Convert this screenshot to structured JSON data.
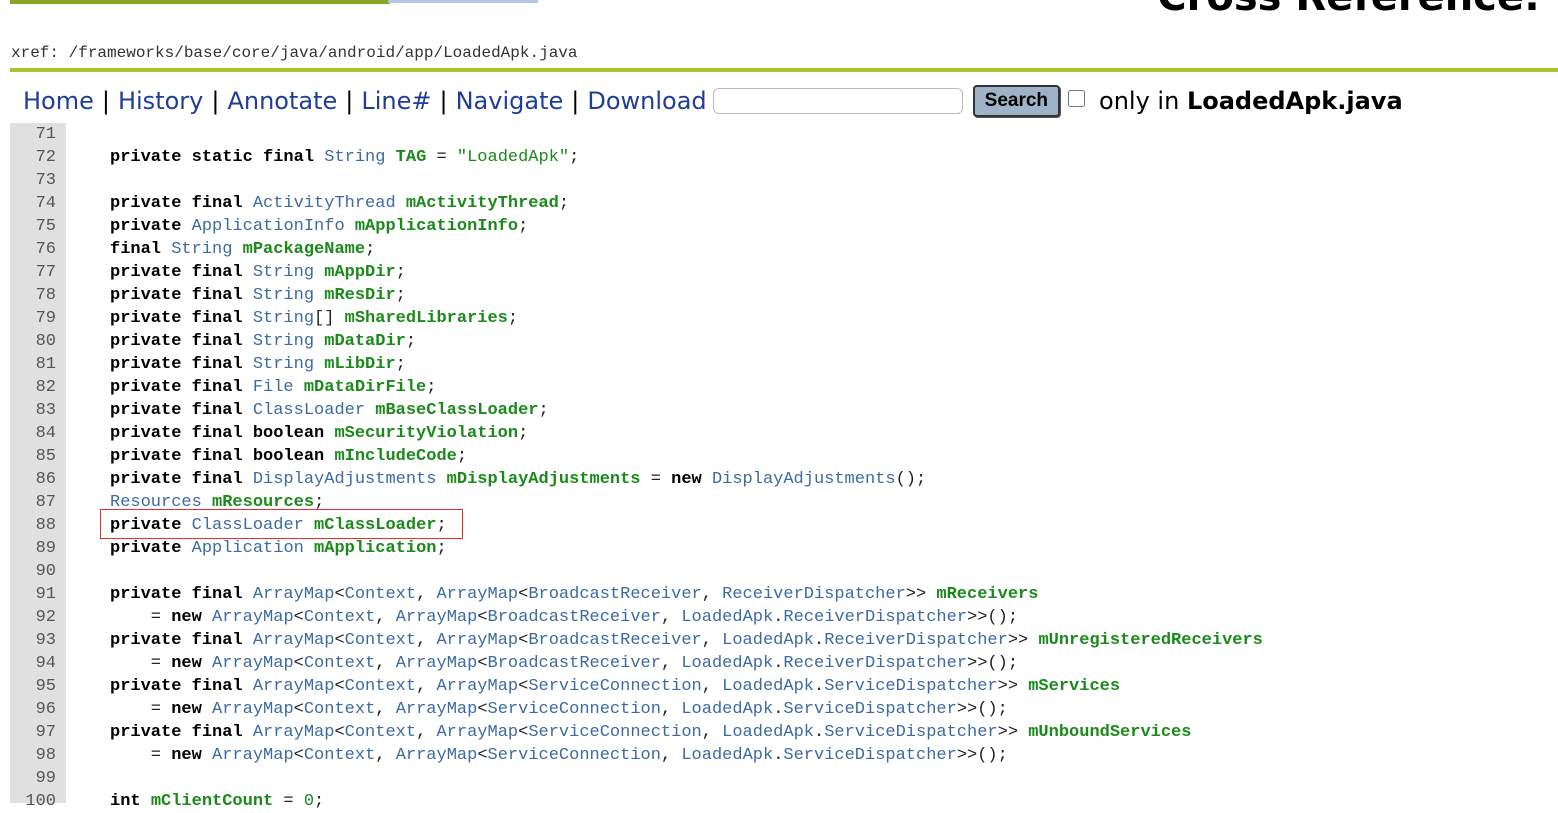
{
  "header": {
    "cross_reference": "Cross Reference:",
    "xref_path": "xref: /frameworks/base/core/java/android/app/LoadedApk.java"
  },
  "nav": {
    "home": "Home",
    "history": "History",
    "annotate": "Annotate",
    "line": "Line#",
    "navigate": "Navigate",
    "download": "Download",
    "search_value": "",
    "search_button": "Search",
    "only_in_prefix": "only in",
    "only_in_file": "LoadedApk.java"
  },
  "code": {
    "lines": [
      {
        "n": "71",
        "segs": []
      },
      {
        "n": "72",
        "segs": [
          [
            "k",
            "private static final "
          ],
          [
            "t",
            "String "
          ],
          [
            "d",
            "TAG"
          ],
          [
            "p",
            " = "
          ],
          [
            "s",
            "\"LoadedApk\""
          ],
          [
            "p",
            ";"
          ]
        ]
      },
      {
        "n": "73",
        "segs": []
      },
      {
        "n": "74",
        "segs": [
          [
            "k",
            "private final "
          ],
          [
            "t",
            "ActivityThread "
          ],
          [
            "d",
            "mActivityThread"
          ],
          [
            "p",
            ";"
          ]
        ]
      },
      {
        "n": "75",
        "segs": [
          [
            "k",
            "private "
          ],
          [
            "t",
            "ApplicationInfo "
          ],
          [
            "d",
            "mApplicationInfo"
          ],
          [
            "p",
            ";"
          ]
        ]
      },
      {
        "n": "76",
        "segs": [
          [
            "k",
            "final "
          ],
          [
            "t",
            "String "
          ],
          [
            "d",
            "mPackageName"
          ],
          [
            "p",
            ";"
          ]
        ]
      },
      {
        "n": "77",
        "segs": [
          [
            "k",
            "private final "
          ],
          [
            "t",
            "String "
          ],
          [
            "d",
            "mAppDir"
          ],
          [
            "p",
            ";"
          ]
        ]
      },
      {
        "n": "78",
        "segs": [
          [
            "k",
            "private final "
          ],
          [
            "t",
            "String "
          ],
          [
            "d",
            "mResDir"
          ],
          [
            "p",
            ";"
          ]
        ]
      },
      {
        "n": "79",
        "segs": [
          [
            "k",
            "private final "
          ],
          [
            "t",
            "String"
          ],
          [
            "p",
            "[] "
          ],
          [
            "d",
            "mSharedLibraries"
          ],
          [
            "p",
            ";"
          ]
        ]
      },
      {
        "n": "80",
        "segs": [
          [
            "k",
            "private final "
          ],
          [
            "t",
            "String "
          ],
          [
            "d",
            "mDataDir"
          ],
          [
            "p",
            ";"
          ]
        ]
      },
      {
        "n": "81",
        "segs": [
          [
            "k",
            "private final "
          ],
          [
            "t",
            "String "
          ],
          [
            "d",
            "mLibDir"
          ],
          [
            "p",
            ";"
          ]
        ]
      },
      {
        "n": "82",
        "segs": [
          [
            "k",
            "private final "
          ],
          [
            "t",
            "File "
          ],
          [
            "d",
            "mDataDirFile"
          ],
          [
            "p",
            ";"
          ]
        ]
      },
      {
        "n": "83",
        "segs": [
          [
            "k",
            "private final "
          ],
          [
            "t",
            "ClassLoader "
          ],
          [
            "d",
            "mBaseClassLoader"
          ],
          [
            "p",
            ";"
          ]
        ]
      },
      {
        "n": "84",
        "segs": [
          [
            "k",
            "private final boolean "
          ],
          [
            "d",
            "mSecurityViolation"
          ],
          [
            "p",
            ";"
          ]
        ]
      },
      {
        "n": "85",
        "segs": [
          [
            "k",
            "private final boolean "
          ],
          [
            "d",
            "mIncludeCode"
          ],
          [
            "p",
            ";"
          ]
        ]
      },
      {
        "n": "86",
        "segs": [
          [
            "k",
            "private final "
          ],
          [
            "t",
            "DisplayAdjustments "
          ],
          [
            "d",
            "mDisplayAdjustments"
          ],
          [
            "p",
            " = "
          ],
          [
            "k",
            "new "
          ],
          [
            "t",
            "DisplayAdjustments"
          ],
          [
            "p",
            "();"
          ]
        ]
      },
      {
        "n": "87",
        "segs": [
          [
            "t",
            "Resources "
          ],
          [
            "d",
            "mResources"
          ],
          [
            "p",
            ";"
          ]
        ]
      },
      {
        "n": "88",
        "segs": [
          [
            "k",
            "private "
          ],
          [
            "t",
            "ClassLoader "
          ],
          [
            "d",
            "mClassLoader"
          ],
          [
            "p",
            ";"
          ]
        ]
      },
      {
        "n": "89",
        "segs": [
          [
            "k",
            "private "
          ],
          [
            "t",
            "Application "
          ],
          [
            "d",
            "mApplication"
          ],
          [
            "p",
            ";"
          ]
        ]
      },
      {
        "n": "90",
        "segs": []
      },
      {
        "n": "91",
        "segs": [
          [
            "k",
            "private final "
          ],
          [
            "t",
            "ArrayMap"
          ],
          [
            "p",
            "<"
          ],
          [
            "t",
            "Context"
          ],
          [
            "p",
            ", "
          ],
          [
            "t",
            "ArrayMap"
          ],
          [
            "p",
            "<"
          ],
          [
            "t",
            "BroadcastReceiver"
          ],
          [
            "p",
            ", "
          ],
          [
            "t",
            "ReceiverDispatcher"
          ],
          [
            "p",
            ">> "
          ],
          [
            "d",
            "mReceivers"
          ]
        ]
      },
      {
        "n": "92",
        "segs": [
          [
            "p",
            "    = "
          ],
          [
            "k",
            "new "
          ],
          [
            "t",
            "ArrayMap"
          ],
          [
            "p",
            "<"
          ],
          [
            "t",
            "Context"
          ],
          [
            "p",
            ", "
          ],
          [
            "t",
            "ArrayMap"
          ],
          [
            "p",
            "<"
          ],
          [
            "t",
            "BroadcastReceiver"
          ],
          [
            "p",
            ", "
          ],
          [
            "t",
            "LoadedApk"
          ],
          [
            "p",
            "."
          ],
          [
            "t",
            "ReceiverDispatcher"
          ],
          [
            "p",
            ">>();"
          ]
        ]
      },
      {
        "n": "93",
        "segs": [
          [
            "k",
            "private final "
          ],
          [
            "t",
            "ArrayMap"
          ],
          [
            "p",
            "<"
          ],
          [
            "t",
            "Context"
          ],
          [
            "p",
            ", "
          ],
          [
            "t",
            "ArrayMap"
          ],
          [
            "p",
            "<"
          ],
          [
            "t",
            "BroadcastReceiver"
          ],
          [
            "p",
            ", "
          ],
          [
            "t",
            "LoadedApk"
          ],
          [
            "p",
            "."
          ],
          [
            "t",
            "ReceiverDispatcher"
          ],
          [
            "p",
            ">> "
          ],
          [
            "d",
            "mUnregisteredReceivers"
          ]
        ]
      },
      {
        "n": "94",
        "segs": [
          [
            "p",
            "    = "
          ],
          [
            "k",
            "new "
          ],
          [
            "t",
            "ArrayMap"
          ],
          [
            "p",
            "<"
          ],
          [
            "t",
            "Context"
          ],
          [
            "p",
            ", "
          ],
          [
            "t",
            "ArrayMap"
          ],
          [
            "p",
            "<"
          ],
          [
            "t",
            "BroadcastReceiver"
          ],
          [
            "p",
            ", "
          ],
          [
            "t",
            "LoadedApk"
          ],
          [
            "p",
            "."
          ],
          [
            "t",
            "ReceiverDispatcher"
          ],
          [
            "p",
            ">>();"
          ]
        ]
      },
      {
        "n": "95",
        "segs": [
          [
            "k",
            "private final "
          ],
          [
            "t",
            "ArrayMap"
          ],
          [
            "p",
            "<"
          ],
          [
            "t",
            "Context"
          ],
          [
            "p",
            ", "
          ],
          [
            "t",
            "ArrayMap"
          ],
          [
            "p",
            "<"
          ],
          [
            "t",
            "ServiceConnection"
          ],
          [
            "p",
            ", "
          ],
          [
            "t",
            "LoadedApk"
          ],
          [
            "p",
            "."
          ],
          [
            "t",
            "ServiceDispatcher"
          ],
          [
            "p",
            ">> "
          ],
          [
            "d",
            "mServices"
          ]
        ]
      },
      {
        "n": "96",
        "segs": [
          [
            "p",
            "    = "
          ],
          [
            "k",
            "new "
          ],
          [
            "t",
            "ArrayMap"
          ],
          [
            "p",
            "<"
          ],
          [
            "t",
            "Context"
          ],
          [
            "p",
            ", "
          ],
          [
            "t",
            "ArrayMap"
          ],
          [
            "p",
            "<"
          ],
          [
            "t",
            "ServiceConnection"
          ],
          [
            "p",
            ", "
          ],
          [
            "t",
            "LoadedApk"
          ],
          [
            "p",
            "."
          ],
          [
            "t",
            "ServiceDispatcher"
          ],
          [
            "p",
            ">>();"
          ]
        ]
      },
      {
        "n": "97",
        "segs": [
          [
            "k",
            "private final "
          ],
          [
            "t",
            "ArrayMap"
          ],
          [
            "p",
            "<"
          ],
          [
            "t",
            "Context"
          ],
          [
            "p",
            ", "
          ],
          [
            "t",
            "ArrayMap"
          ],
          [
            "p",
            "<"
          ],
          [
            "t",
            "ServiceConnection"
          ],
          [
            "p",
            ", "
          ],
          [
            "t",
            "LoadedApk"
          ],
          [
            "p",
            "."
          ],
          [
            "t",
            "ServiceDispatcher"
          ],
          [
            "p",
            ">> "
          ],
          [
            "d",
            "mUnboundServices"
          ]
        ]
      },
      {
        "n": "98",
        "segs": [
          [
            "p",
            "    = "
          ],
          [
            "k",
            "new "
          ],
          [
            "t",
            "ArrayMap"
          ],
          [
            "p",
            "<"
          ],
          [
            "t",
            "Context"
          ],
          [
            "p",
            ", "
          ],
          [
            "t",
            "ArrayMap"
          ],
          [
            "p",
            "<"
          ],
          [
            "t",
            "ServiceConnection"
          ],
          [
            "p",
            ", "
          ],
          [
            "t",
            "LoadedApk"
          ],
          [
            "p",
            "."
          ],
          [
            "t",
            "ServiceDispatcher"
          ],
          [
            "p",
            ">>();"
          ]
        ]
      },
      {
        "n": "99",
        "segs": []
      },
      {
        "n": "100",
        "segs": [
          [
            "k",
            "int "
          ],
          [
            "d",
            "mClientCount"
          ],
          [
            "p",
            " = "
          ],
          [
            "s",
            "0"
          ],
          [
            "p",
            ";"
          ]
        ]
      }
    ]
  }
}
